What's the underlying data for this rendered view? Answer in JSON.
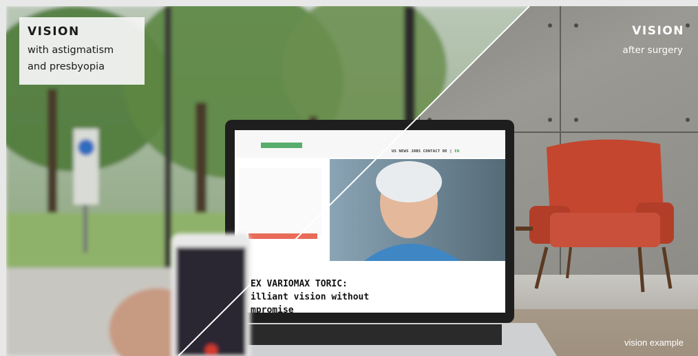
{
  "left_label": {
    "title": "VISION",
    "line1": "with astigmatism",
    "line2": "and presbyopia"
  },
  "right_label": {
    "title": "VISION",
    "subtitle": "after surgery"
  },
  "footnote": "vision example",
  "laptop_site": {
    "nav_text": "US NEWS JOBS CONTACT DE |",
    "nav_lang": "EN",
    "headline_line1": "EX VARIOMAX TORIC:",
    "headline_line2": "illiant vision without",
    "headline_line3": "mpromise"
  },
  "colors": {
    "frame": "#e8e8e8",
    "chair": "#c4462e",
    "wall": "#8c8b87",
    "tree_green": "#4f7a3a",
    "label_bg": "#f5f5f5"
  }
}
